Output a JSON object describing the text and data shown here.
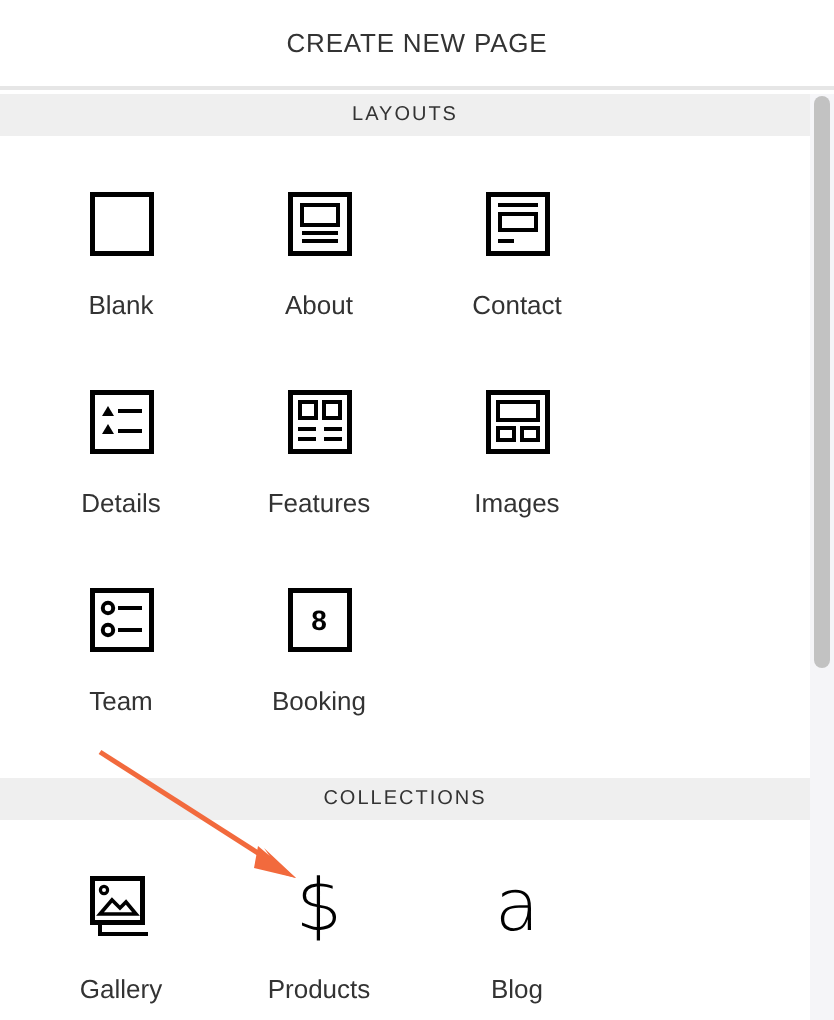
{
  "title": "CREATE NEW PAGE",
  "sections": [
    {
      "title": "LAYOUTS",
      "items": [
        {
          "label": "Blank",
          "kind": "blank"
        },
        {
          "label": "About",
          "kind": "about"
        },
        {
          "label": "Contact",
          "kind": "contact"
        },
        {
          "label": "Details",
          "kind": "details"
        },
        {
          "label": "Features",
          "kind": "features"
        },
        {
          "label": "Images",
          "kind": "images"
        },
        {
          "label": "Team",
          "kind": "team"
        },
        {
          "label": "Booking",
          "kind": "booking",
          "glyph": "8"
        }
      ]
    },
    {
      "title": "COLLECTIONS",
      "items": [
        {
          "label": "Gallery",
          "kind": "gallery"
        },
        {
          "label": "Products",
          "kind": "glyph",
          "glyph": "$"
        },
        {
          "label": "Blog",
          "kind": "glyph",
          "glyph": "a"
        }
      ]
    }
  ]
}
